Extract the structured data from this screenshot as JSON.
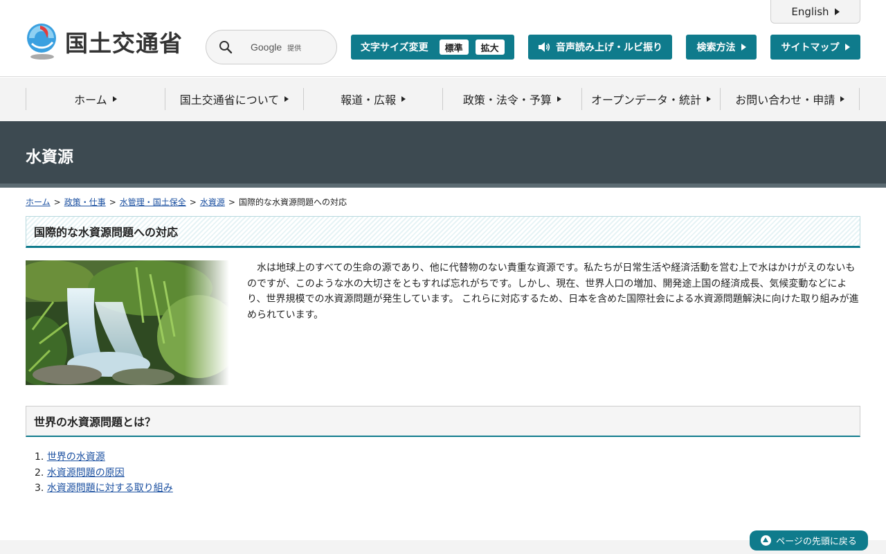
{
  "header": {
    "logo_text": "国土交通省",
    "english_label": "English",
    "search": {
      "brand": "Google",
      "provided": "提供"
    },
    "fontsize": {
      "label": "文字サイズ変更",
      "standard": "標準",
      "large": "拡大"
    },
    "voice_label": "音声読み上げ・ルビ振り",
    "search_method_label": "検索方法",
    "sitemap_label": "サイトマップ"
  },
  "gnav": {
    "items": [
      {
        "label": "ホーム"
      },
      {
        "label": "国土交通省について"
      },
      {
        "label": "報道・広報"
      },
      {
        "label": "政策・法令・予算"
      },
      {
        "label": "オープンデータ・統計"
      },
      {
        "label": "お問い合わせ・申請"
      }
    ]
  },
  "page": {
    "title": "水資源",
    "breadcrumb": [
      "ホーム",
      "政策・仕事",
      "水管理・国土保全",
      "水資源",
      "国際的な水資源問題への対応"
    ],
    "breadcrumb_sep": ">",
    "heading": "国際的な水資源問題への対応",
    "intro": "水は地球上のすべての生命の源であり、他に代替物のない貴重な資源です。私たちが日常生活や経済活動を営む上で水はかけがえのないものですが、このような水の大切さをともすれば忘れがちです。しかし、現在、世界人口の増加、開発途上国の経済成長、気候変動などにより、世界規模での水資源問題が発生しています。 これらに対応するため、日本を含めた国際社会による水資源問題解決に向けた取り組みが進められています。",
    "subheading": "世界の水資源問題とは？",
    "list": [
      {
        "num": "1.",
        "label": "世界の水資源 "
      },
      {
        "num": "2.",
        "label": "水資源問題の原因"
      },
      {
        "num": "3.",
        "label": "水資源問題に対する取り組み"
      }
    ],
    "pagetop_label": "ページの先頭に戻る"
  },
  "colors": {
    "accent": "#0f7b8c",
    "title_band": "#3d4a51",
    "link": "#1a4fa0"
  }
}
